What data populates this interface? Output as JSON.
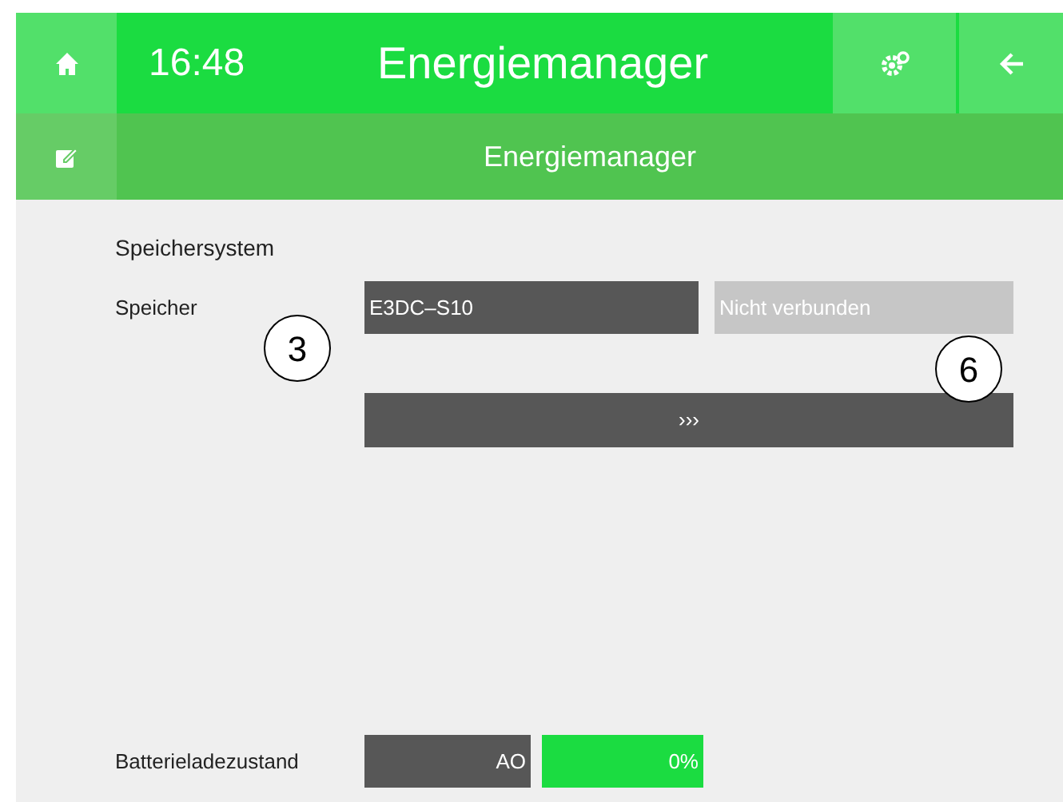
{
  "header": {
    "time": "16:48",
    "title": "Energiemanager"
  },
  "subheader": {
    "title": "Energiemanager"
  },
  "section": {
    "title": "Speichersystem"
  },
  "storage": {
    "label": "Speicher",
    "device": "E3DC–S10",
    "status": "Nicht verbunden",
    "more_button": "›››"
  },
  "battery": {
    "label": "Batterieladezustand",
    "address": "AO",
    "value": "0%"
  },
  "callouts": [
    "3",
    "6"
  ]
}
